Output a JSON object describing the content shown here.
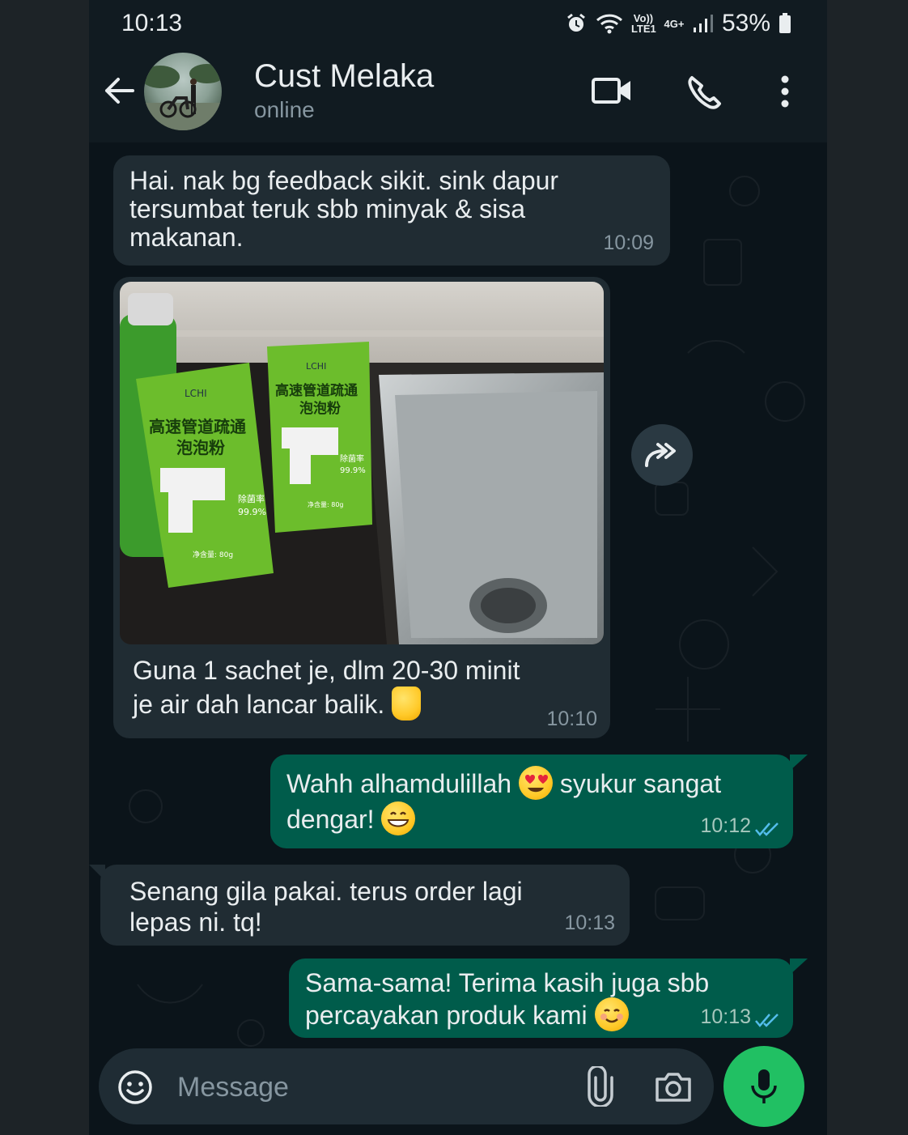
{
  "status_bar": {
    "time": "10:13",
    "volte": "Vo)) LTE1",
    "network": "4G+",
    "battery": "53%"
  },
  "header": {
    "contact_name": "Cust Melaka",
    "contact_status": "online",
    "icons": [
      "back-arrow-icon",
      "video-call-icon",
      "voice-call-icon",
      "more-options-icon"
    ]
  },
  "messages": [
    {
      "direction": "incoming",
      "text": "Hai. nak bg feedback sikit. sink dapur tersumbat teruk sbb minyak & sisa makanan.",
      "time": "10:09"
    },
    {
      "direction": "incoming",
      "image": {
        "brand": "LCHI",
        "product_name_1": "高速管道疏通",
        "product_name_2": "泡泡粉",
        "badge": "除菌率",
        "badge_pct": "99.9%",
        "net_weight": "净含量: 80g"
      },
      "text_part1": "Guna 1 sachet je, dlm 20-30 minit",
      "text_part2": "je air dah lancar balik.",
      "emoji": "thumbs-up",
      "time": "10:10"
    },
    {
      "direction": "outgoing",
      "text_part1": "Wahh alhamdulillah",
      "emoji1": "heart-eyes",
      "text_part2": "syukur sangat",
      "text_part3": "dengar!",
      "emoji2": "grinning",
      "time": "10:12",
      "status": "read"
    },
    {
      "direction": "incoming",
      "text": "Senang gila pakai. terus order lagi lepas ni. tq!",
      "time": "10:13"
    },
    {
      "direction": "outgoing",
      "text_part1": "Sama-sama! Terima kasih juga sbb",
      "text_part2": "percayakan produk kami",
      "emoji": "smiling",
      "time": "10:13",
      "status": "read"
    }
  ],
  "input": {
    "placeholder": "Message"
  },
  "colors": {
    "header_bg": "#111b21",
    "chat_bg": "#0b141a",
    "incoming_bubble": "#202c33",
    "outgoing_bubble": "#005c4b",
    "read_ticks": "#53bdeb",
    "mic_button": "#21c063"
  }
}
